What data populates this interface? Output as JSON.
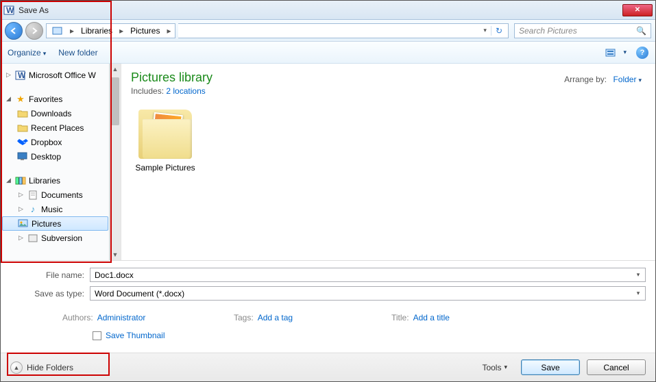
{
  "window": {
    "title": "Save As"
  },
  "breadcrumb": {
    "root": "Libraries",
    "current": "Pictures"
  },
  "search": {
    "placeholder": "Search Pictures"
  },
  "toolbar": {
    "organize": "Organize",
    "newfolder": "New folder"
  },
  "tree": {
    "office": "Microsoft Office W",
    "favorites": "Favorites",
    "fav_items": {
      "downloads": "Downloads",
      "recent": "Recent Places",
      "dropbox": "Dropbox",
      "desktop": "Desktop"
    },
    "libraries": "Libraries",
    "lib_items": {
      "documents": "Documents",
      "music": "Music",
      "pictures": "Pictures",
      "subversion": "Subversion"
    }
  },
  "content": {
    "header": "Pictures library",
    "includes_label": "Includes:",
    "includes_link": "2 locations",
    "arrange_label": "Arrange by:",
    "arrange_value": "Folder",
    "item_label": "Sample Pictures"
  },
  "form": {
    "filename_label": "File name:",
    "filename_value": "Doc1.docx",
    "type_label": "Save as type:",
    "type_value": "Word Document (*.docx)",
    "authors_label": "Authors:",
    "authors_value": "Administrator",
    "tags_label": "Tags:",
    "tags_value": "Add a tag",
    "title_label": "Title:",
    "title_value": "Add a title",
    "save_thumbnail": "Save Thumbnail"
  },
  "footer": {
    "hide_folders": "Hide Folders",
    "tools": "Tools",
    "save": "Save",
    "cancel": "Cancel"
  }
}
